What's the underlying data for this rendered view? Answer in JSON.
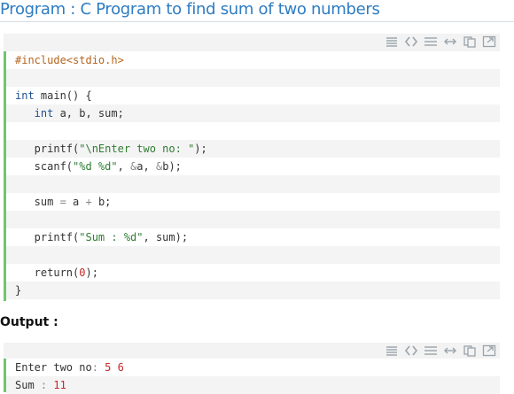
{
  "page": {
    "title": "Program : C Program to find sum of two numbers",
    "output_label": "Output :"
  },
  "toolbar": {
    "icons": [
      "view-plain-icon",
      "view-source-icon",
      "print-icon",
      "wrap-icon",
      "copy-icon",
      "popup-icon"
    ]
  },
  "code_block": {
    "lines": [
      [
        {
          "t": "#include<stdio.h>",
          "c": "pp"
        }
      ],
      [],
      [
        {
          "t": "int",
          "c": "kw"
        },
        {
          "t": " main() {",
          "c": ""
        }
      ],
      [
        {
          "t": "   int",
          "c": "kw"
        },
        {
          "t": " a, b, sum;",
          "c": ""
        }
      ],
      [],
      [
        {
          "t": "   printf(",
          "c": ""
        },
        {
          "t": "\"\\nEnter two no: \"",
          "c": "str"
        },
        {
          "t": ");",
          "c": ""
        }
      ],
      [
        {
          "t": "   scanf(",
          "c": ""
        },
        {
          "t": "\"%d %d\"",
          "c": "str"
        },
        {
          "t": ", ",
          "c": ""
        },
        {
          "t": "&",
          "c": "op"
        },
        {
          "t": "a, ",
          "c": ""
        },
        {
          "t": "&",
          "c": "op"
        },
        {
          "t": "b);",
          "c": ""
        }
      ],
      [],
      [
        {
          "t": "   sum ",
          "c": ""
        },
        {
          "t": "=",
          "c": "op"
        },
        {
          "t": " a ",
          "c": ""
        },
        {
          "t": "+",
          "c": "op"
        },
        {
          "t": " b;",
          "c": ""
        }
      ],
      [],
      [
        {
          "t": "   printf(",
          "c": ""
        },
        {
          "t": "\"Sum : %d\"",
          "c": "str"
        },
        {
          "t": ", sum);",
          "c": ""
        }
      ],
      [],
      [
        {
          "t": "   return(",
          "c": ""
        },
        {
          "t": "0",
          "c": "num"
        },
        {
          "t": ");",
          "c": ""
        }
      ],
      [
        {
          "t": "}",
          "c": ""
        }
      ]
    ]
  },
  "output_block": {
    "lines": [
      [
        {
          "t": "Enter two no",
          "c": ""
        },
        {
          "t": ":",
          "c": "op"
        },
        {
          "t": " ",
          "c": ""
        },
        {
          "t": "5",
          "c": "num"
        },
        {
          "t": " ",
          "c": ""
        },
        {
          "t": "6",
          "c": "num"
        }
      ],
      [
        {
          "t": "Sum ",
          "c": ""
        },
        {
          "t": ":",
          "c": "op"
        },
        {
          "t": " ",
          "c": ""
        },
        {
          "t": "11",
          "c": "num"
        }
      ]
    ]
  }
}
